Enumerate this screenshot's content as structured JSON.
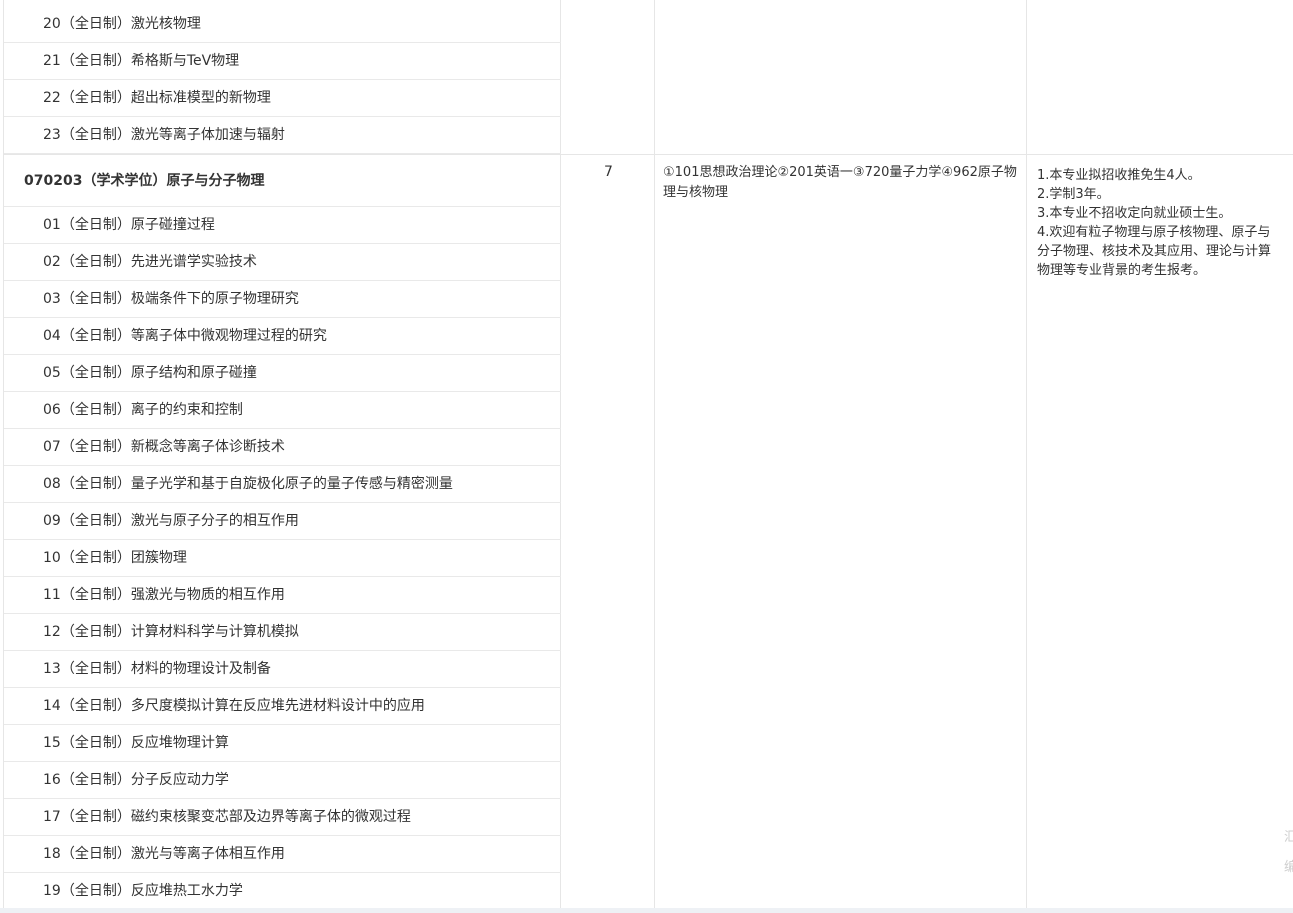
{
  "directions_top": [
    "20（全日制）激光核物理",
    "21（全日制）希格斯与TeV物理",
    "22（全日制）超出标准模型的新物理",
    "23（全日制）激光等离子体加速与辐射"
  ],
  "major": {
    "title": "070203（学术学位）原子与分子物理",
    "count": "7",
    "exam": "①101思想政治理论②201英语一③720量子力学④962原子物理与核物理",
    "notes": [
      "1.本专业拟招收推免生4人。",
      "2.学制3年。",
      "3.本专业不招收定向就业硕士生。",
      "4.欢迎有粒子物理与原子核物理、原子与",
      "分子物理、核技术及其应用、理论与计算",
      "物理等专业背景的考生报考。"
    ],
    "directions": [
      "01（全日制）原子碰撞过程",
      "02（全日制）先进光谱学实验技术",
      "03（全日制）极端条件下的原子物理研究",
      "04（全日制）等离子体中微观物理过程的研究",
      "05（全日制）原子结构和原子碰撞",
      "06（全日制）离子的约束和控制",
      "07（全日制）新概念等离子体诊断技术",
      "08（全日制）量子光学和基于自旋极化原子的量子传感与精密测量",
      "09（全日制）激光与原子分子的相互作用",
      "10（全日制）团簇物理",
      "11（全日制）强激光与物质的相互作用",
      "12（全日制）计算材料科学与计算机模拟",
      "13（全日制）材料的物理设计及制备",
      "14（全日制）多尺度模拟计算在反应堆先进材料设计中的应用",
      "15（全日制）反应堆物理计算",
      "16（全日制）分子反应动力学",
      "17（全日制）磁约束核聚变芯部及边界等离子体的微观过程",
      "18（全日制）激光与等离子体相互作用",
      "19（全日制）反应堆热工水力学"
    ]
  },
  "edge_glyphs": [
    "汇",
    "编"
  ]
}
